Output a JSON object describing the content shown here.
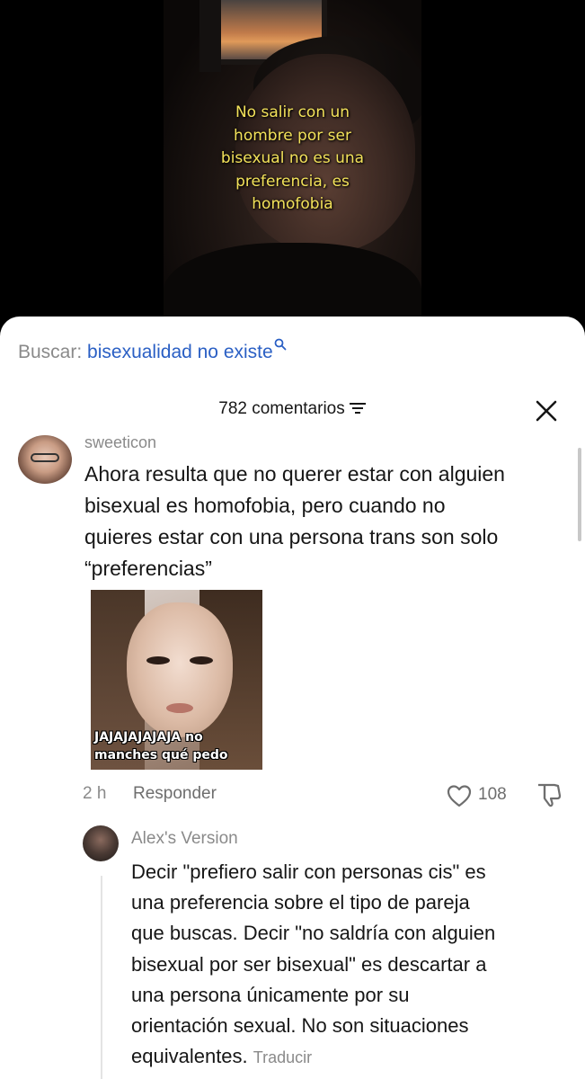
{
  "video": {
    "caption": "No salir con un\nhombre por ser\nbisexual no es una\npreferencia, es\nhomofobia"
  },
  "search": {
    "label": "Buscar:",
    "query": "bisexualidad no existe"
  },
  "comments": {
    "count_label": "782 comentarios",
    "items": [
      {
        "username": "sweeticon",
        "text": "Ahora resulta que no querer estar con alguien\nbisexual es homofobia, pero cuando no\nquieres estar con una persona trans son solo\n“preferencias”",
        "gif_caption": "JAJAJAJAJAJA no\nmanches qué pedo",
        "time": "2 h",
        "reply_label": "Responder",
        "likes": "108"
      }
    ],
    "replies": [
      {
        "username": "Alex's Version",
        "text": "Decir \"prefiero salir con personas cis\" es\nuna preferencia sobre el tipo de pareja\nque buscas. Decir \"no saldría con alguien\nbisexual por ser bisexual\" es descartar a\nuna persona únicamente por su\norientación sexual. No son situaciones\nequivalentes.",
        "translate_label": "Traducir"
      }
    ]
  },
  "colors": {
    "caption_yellow": "#f3e25a",
    "search_blue": "#2a5fc4",
    "muted_gray": "#8a8a8a",
    "text": "#161616"
  }
}
